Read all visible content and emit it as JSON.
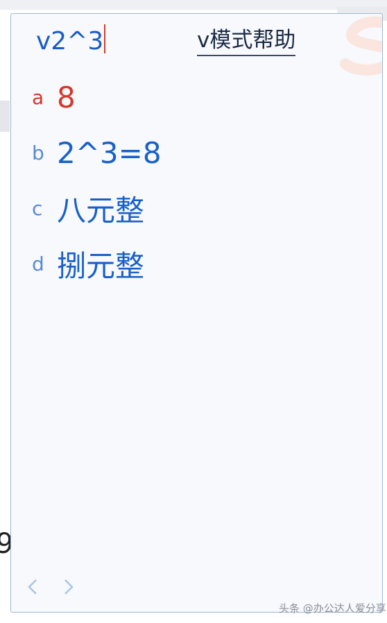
{
  "input": {
    "text": "v2^3"
  },
  "help_link": "v模式帮助",
  "candidates": [
    {
      "key": "a",
      "value": "8",
      "selected": true
    },
    {
      "key": "b",
      "value": "2^3=8",
      "selected": false
    },
    {
      "key": "c",
      "value": "八元整",
      "selected": false
    },
    {
      "key": "d",
      "value": "捌元整",
      "selected": false
    }
  ],
  "icons": {
    "prev": "chevron-left-icon",
    "next": "chevron-right-icon",
    "brand": "sogou-s-logo"
  },
  "background_text": "9",
  "watermark": "头条 @办公达人爱分享",
  "colors": {
    "input": "#1a5bc7",
    "candidate": "#1760c9",
    "selected": "#d8362a",
    "border": "#9fb6d6"
  }
}
